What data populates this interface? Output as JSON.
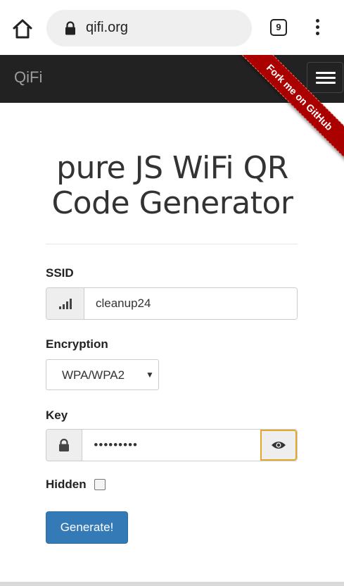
{
  "browser": {
    "url": "qifi.org",
    "tab_count": "9"
  },
  "navbar": {
    "brand": "QiFi",
    "ribbon": "Fork me on GitHub"
  },
  "main": {
    "title": "pure JS WiFi QR Code Generator",
    "ssid": {
      "label": "SSID",
      "value": "cleanup24"
    },
    "encryption": {
      "label": "Encryption",
      "selected": "WPA/WPA2"
    },
    "key": {
      "label": "Key",
      "value": "•••••••••"
    },
    "hidden": {
      "label": "Hidden",
      "checked": false
    },
    "generate_label": "Generate!"
  },
  "colors": {
    "navbar": "#222222",
    "ribbon": "#aa0000",
    "primary_button": "#337ab7",
    "focus_border": "#e0a92a"
  }
}
